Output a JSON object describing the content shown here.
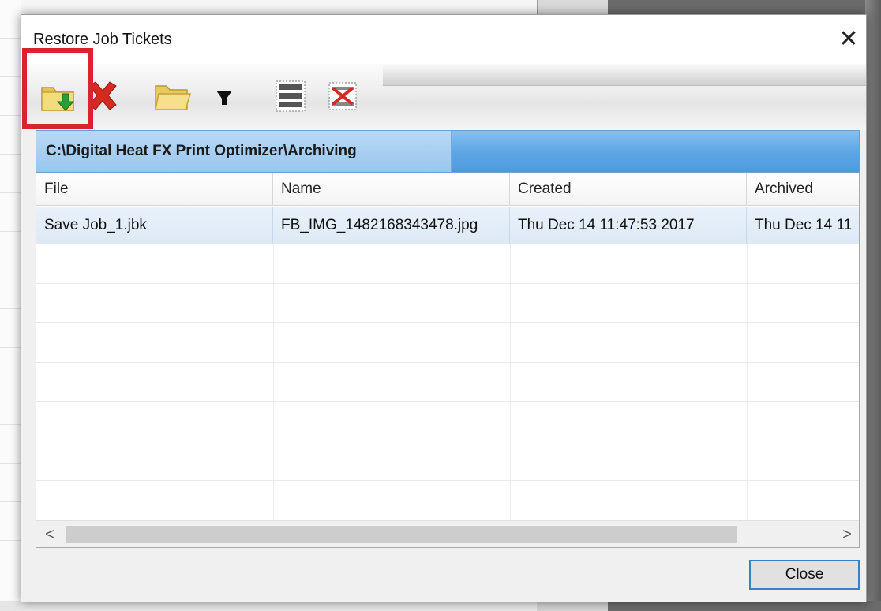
{
  "dialog": {
    "title": "Restore Job Tickets",
    "close_glyph": "✕",
    "close_button_label": "Close"
  },
  "toolbar": {
    "buttons": [
      {
        "name": "restore-folder-icon",
        "tooltip": ""
      },
      {
        "name": "delete-x-icon",
        "tooltip": ""
      },
      {
        "name": "open-folder-icon",
        "tooltip": ""
      },
      {
        "name": "filter-funnel-icon",
        "tooltip": ""
      },
      {
        "name": "select-all-rows-icon",
        "tooltip": ""
      },
      {
        "name": "deselect-rows-icon",
        "tooltip": ""
      }
    ],
    "highlight_color": "#d9232e"
  },
  "path_header": {
    "path": "C:\\Digital Heat FX Print Optimizer\\Archiving"
  },
  "table": {
    "columns": [
      "File",
      "Name",
      "Created",
      "Archived"
    ],
    "rows": [
      [
        "Save Job_1.jbk",
        "FB_IMG_1482168343478.jpg",
        "Thu Dec 14 11:47:53 2017",
        "Thu Dec 14 11"
      ]
    ]
  },
  "scrollbar": {
    "left_arrow": "<",
    "right_arrow": ">"
  },
  "colors": {
    "path_header_blue": "#5fa7e6",
    "selected_row": "#e3eef9",
    "focus_border": "#3c7fc9"
  }
}
